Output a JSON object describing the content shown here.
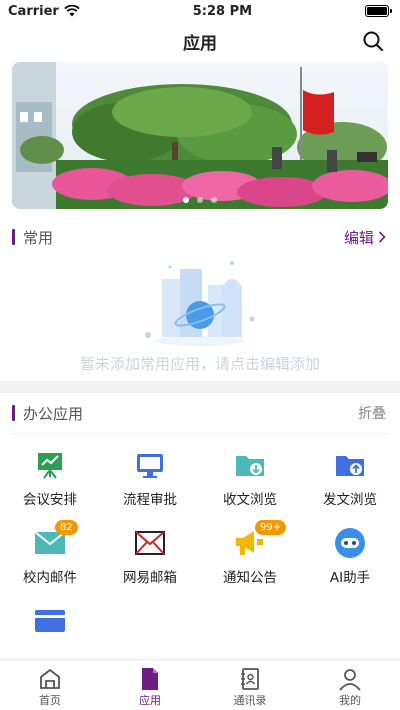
{
  "status_bar": {
    "carrier": "Carrier",
    "time": "5:28 PM"
  },
  "nav": {
    "title": "应用"
  },
  "banner": {
    "page_count": 3,
    "active_page": 1
  },
  "common": {
    "title": "常用",
    "edit_label": "编辑",
    "empty_text": "暂未添加常用应用，请点击编辑添加"
  },
  "office": {
    "title": "办公应用",
    "fold_label": "折叠",
    "apps": [
      {
        "label": "会议安排",
        "icon": "meeting-icon",
        "color": "#2aa052"
      },
      {
        "label": "流程审批",
        "icon": "monitor-icon",
        "color": "#3f6fe0"
      },
      {
        "label": "收文浏览",
        "icon": "folder-download-icon",
        "color": "#4db8b8"
      },
      {
        "label": "发文浏览",
        "icon": "folder-upload-icon",
        "color": "#3f6fe0"
      },
      {
        "label": "校内邮件",
        "icon": "mail-icon",
        "color": "#4db8b8",
        "badge": "82"
      },
      {
        "label": "网易邮箱",
        "icon": "envelope-icon",
        "color": "#c62828"
      },
      {
        "label": "通知公告",
        "icon": "megaphone-icon",
        "color": "#f2b705",
        "badge": "99+"
      },
      {
        "label": "AI助手",
        "icon": "ai-assistant-icon",
        "color": "#3a8ee6"
      },
      {
        "label": "",
        "icon": "card-icon",
        "color": "#3f6fe0"
      }
    ]
  },
  "tabbar": {
    "active": 1,
    "tabs": [
      {
        "label": "首页",
        "icon": "home-icon"
      },
      {
        "label": "应用",
        "icon": "apps-doc-icon"
      },
      {
        "label": "通讯录",
        "icon": "contacts-icon"
      },
      {
        "label": "我的",
        "icon": "profile-icon"
      }
    ]
  }
}
